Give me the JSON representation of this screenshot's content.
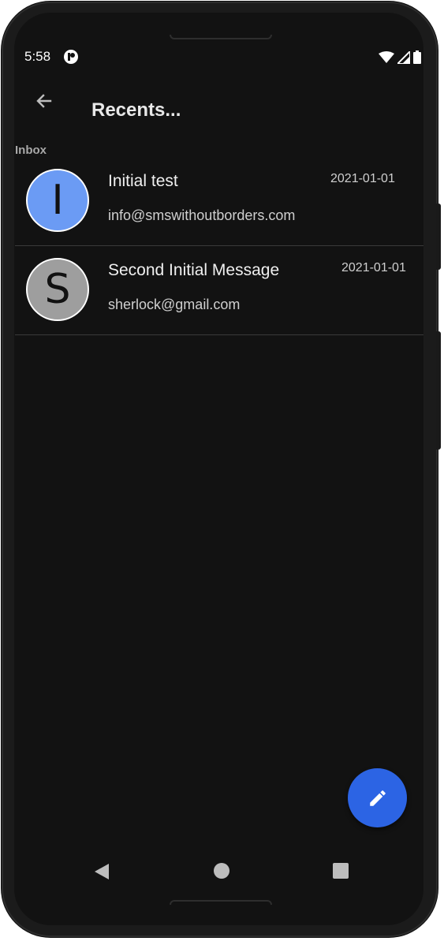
{
  "status_bar": {
    "time": "5:58",
    "icons": [
      "app-notification-icon",
      "wifi-icon",
      "signal-icon",
      "battery-icon"
    ]
  },
  "app_bar": {
    "title": "Recents...",
    "back_icon": "arrow-back-icon"
  },
  "section": {
    "label": "Inbox"
  },
  "messages": [
    {
      "initial": "I",
      "title": "Initial test",
      "sender": "info@smswithoutborders.com",
      "date": "2021-01-01",
      "avatar_color": "#6b9bf4"
    },
    {
      "initial": "S",
      "title": "Second Initial Message",
      "sender": "sherlock@gmail.com",
      "date": "2021-01-01",
      "avatar_color": "#9e9e9e"
    }
  ],
  "fab": {
    "icon": "pencil-icon",
    "color": "#2c64e4"
  },
  "nav_bar": {
    "icons": [
      "nav-back-icon",
      "nav-home-icon",
      "nav-recents-icon"
    ]
  },
  "colors": {
    "background": "#121212",
    "text_primary": "#f0f0f0",
    "text_secondary": "#cfcfcf",
    "divider": "#3a3a3a"
  }
}
